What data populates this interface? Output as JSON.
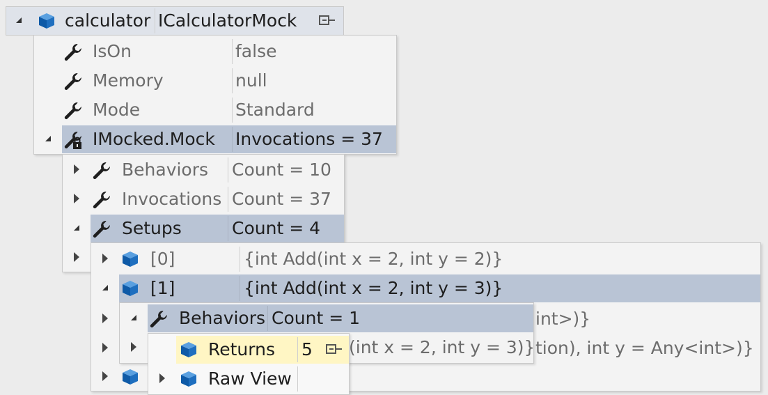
{
  "root": {
    "name": "calculator",
    "value": "ICalculatorMock"
  },
  "level1": [
    {
      "name": "IsOn",
      "value": "false"
    },
    {
      "name": "Memory",
      "value": "null"
    },
    {
      "name": "Mode",
      "value": "Standard"
    },
    {
      "name": "IMocked.Mock",
      "value": "Invocations = 37"
    }
  ],
  "level2": [
    {
      "name": "Behaviors",
      "value": "Count = 10"
    },
    {
      "name": "Invocations",
      "value": "Count = 37"
    },
    {
      "name": "Setups",
      "value": "Count = 4"
    }
  ],
  "level3": [
    {
      "name": "[0]",
      "value": "{int Add(int x = 2, int y = 2)}"
    },
    {
      "name": "[1]",
      "value": "{int Add(int x = 2, int y = 3)}"
    }
  ],
  "obscured": {
    "row3": "int>)}",
    "row4a": "(int x = 2, int y = 3)}",
    "row4b": "tion), int y = Any<int>)}"
  },
  "level4": {
    "name": "Behaviors",
    "value": "Count = 1"
  },
  "level5": [
    {
      "name": "Returns",
      "value": "5"
    },
    {
      "name": "Raw View",
      "value": ""
    }
  ]
}
